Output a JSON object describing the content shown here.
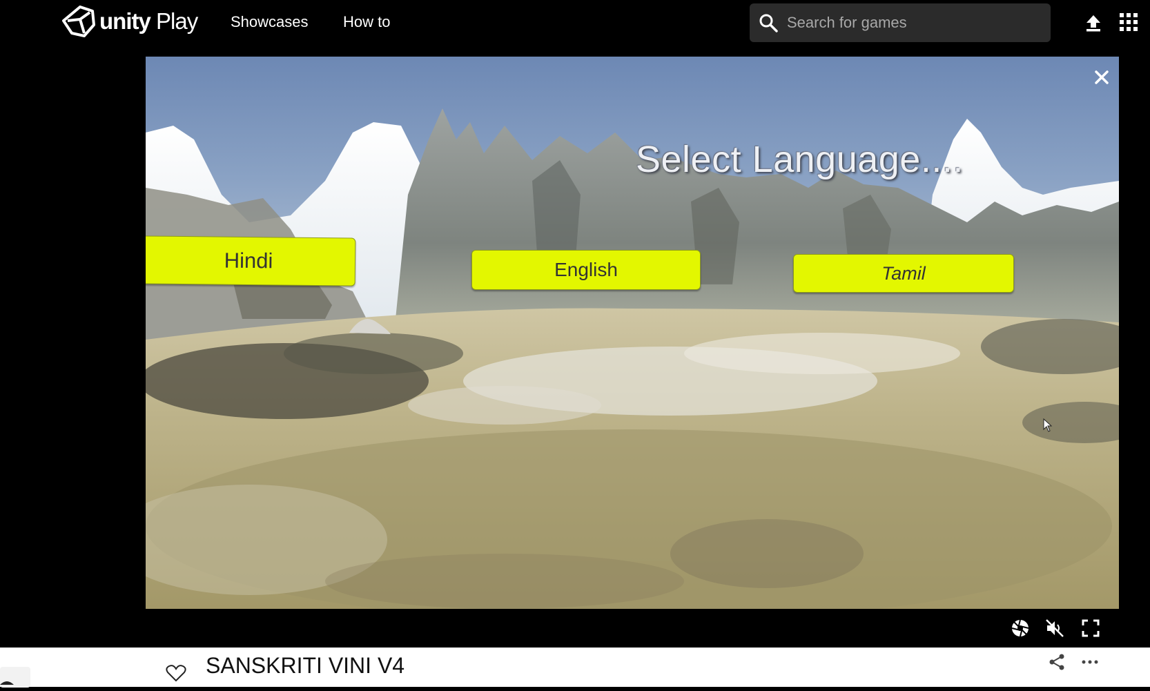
{
  "brand": {
    "logo_bold": "unity",
    "logo_light": " Play"
  },
  "nav": {
    "links": [
      {
        "label": "Showcases"
      },
      {
        "label": "How to"
      }
    ]
  },
  "search": {
    "placeholder": "Search for games"
  },
  "game": {
    "title": "Select Language....",
    "buttons": [
      {
        "label": "Hindi"
      },
      {
        "label": "English"
      },
      {
        "label": "Tamil"
      }
    ]
  },
  "info": {
    "game_name": "SANSKRITI VINI V4"
  },
  "colors": {
    "button_yellow": "#e3f700",
    "background": "#000000",
    "info_bg": "#ffffff"
  }
}
